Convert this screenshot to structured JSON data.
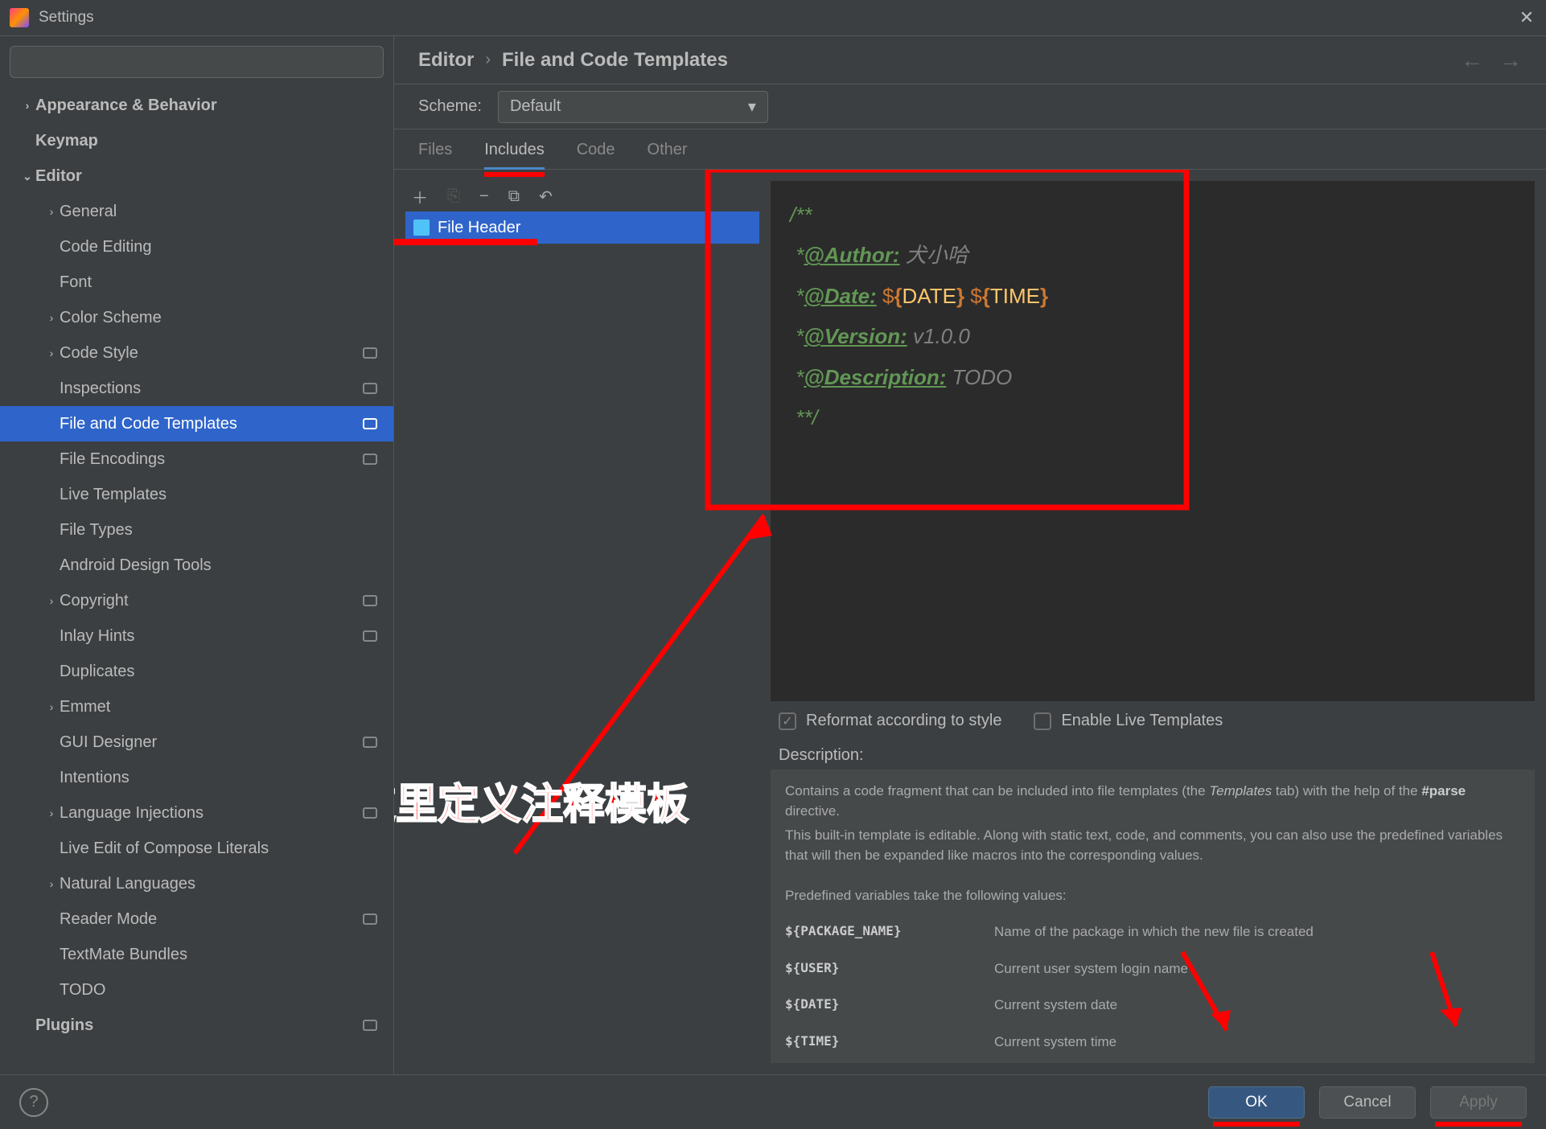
{
  "window": {
    "title": "Settings"
  },
  "sidebar": {
    "search_placeholder": "",
    "items": [
      {
        "label": "Appearance & Behavior",
        "depth": 1,
        "chevron": "right",
        "bold": true
      },
      {
        "label": "Keymap",
        "depth": 1,
        "chevron": "",
        "bold": true
      },
      {
        "label": "Editor",
        "depth": 1,
        "chevron": "down",
        "bold": true
      },
      {
        "label": "General",
        "depth": 2,
        "chevron": "right"
      },
      {
        "label": "Code Editing",
        "depth": 2,
        "chevron": ""
      },
      {
        "label": "Font",
        "depth": 2,
        "chevron": ""
      },
      {
        "label": "Color Scheme",
        "depth": 2,
        "chevron": "right"
      },
      {
        "label": "Code Style",
        "depth": 2,
        "chevron": "right",
        "badge": true
      },
      {
        "label": "Inspections",
        "depth": 2,
        "chevron": "",
        "badge": true
      },
      {
        "label": "File and Code Templates",
        "depth": 2,
        "chevron": "",
        "selected": true,
        "badge": true
      },
      {
        "label": "File Encodings",
        "depth": 2,
        "chevron": "",
        "badge": true
      },
      {
        "label": "Live Templates",
        "depth": 2,
        "chevron": ""
      },
      {
        "label": "File Types",
        "depth": 2,
        "chevron": ""
      },
      {
        "label": "Android Design Tools",
        "depth": 2,
        "chevron": ""
      },
      {
        "label": "Copyright",
        "depth": 2,
        "chevron": "right",
        "badge": true
      },
      {
        "label": "Inlay Hints",
        "depth": 2,
        "chevron": "",
        "badge": true
      },
      {
        "label": "Duplicates",
        "depth": 2,
        "chevron": ""
      },
      {
        "label": "Emmet",
        "depth": 2,
        "chevron": "right"
      },
      {
        "label": "GUI Designer",
        "depth": 2,
        "chevron": "",
        "badge": true
      },
      {
        "label": "Intentions",
        "depth": 2,
        "chevron": ""
      },
      {
        "label": "Language Injections",
        "depth": 2,
        "chevron": "right",
        "badge": true
      },
      {
        "label": "Live Edit of Compose Literals",
        "depth": 2,
        "chevron": ""
      },
      {
        "label": "Natural Languages",
        "depth": 2,
        "chevron": "right"
      },
      {
        "label": "Reader Mode",
        "depth": 2,
        "chevron": "",
        "badge": true
      },
      {
        "label": "TextMate Bundles",
        "depth": 2,
        "chevron": ""
      },
      {
        "label": "TODO",
        "depth": 2,
        "chevron": ""
      },
      {
        "label": "Plugins",
        "depth": 1,
        "chevron": "",
        "bold": true,
        "badge": true
      }
    ]
  },
  "breadcrumb": {
    "main": "Editor",
    "sub": "File and Code Templates"
  },
  "scheme": {
    "label": "Scheme:",
    "value": "Default"
  },
  "tabs": [
    {
      "label": "Files"
    },
    {
      "label": "Includes",
      "active": true,
      "underline_red": true
    },
    {
      "label": "Code"
    },
    {
      "label": "Other"
    }
  ],
  "list": {
    "items": [
      {
        "label": "File Header",
        "selected": true
      }
    ]
  },
  "code": {
    "l1": "/**",
    "l2_star": " *",
    "l2_tag": "@Author:",
    "l2_val": " 犬小哈",
    "l3_star": " *",
    "l3_tag": "@Date:",
    "l3_dollar": " $",
    "l3_bo": "{",
    "l3_var": "DATE",
    "l3_bc": "}",
    "l3_dollar2": " $",
    "l3_bo2": "{",
    "l3_var2": "TIME",
    "l3_bc2": "}",
    "l4_star": " *",
    "l4_tag": "@Version:",
    "l4_val": " v1.0.0",
    "l5_star": " *",
    "l5_tag": "@Description:",
    "l5_val": " TODO",
    "l6": " **/"
  },
  "options": {
    "reformat": "Reformat according to style",
    "livetpl": "Enable Live Templates"
  },
  "description": {
    "label": "Description:",
    "text1a": "Contains a code fragment that can be included into file templates (the ",
    "text1_em": "Templates",
    "text1b": " tab) with the help of the ",
    "text1_bold": "#parse",
    "text1c": " directive.",
    "text2": "This built-in template is editable. Along with static text, code, and comments, you can also use the predefined variables that will then be expanded like macros into the corresponding values.",
    "text3": "Predefined variables take the following values:",
    "vars": [
      {
        "name": "${PACKAGE_NAME}",
        "desc": "Name of the package in which the new file is created"
      },
      {
        "name": "${USER}",
        "desc": "Current user system login name"
      },
      {
        "name": "${DATE}",
        "desc": "Current system date"
      },
      {
        "name": "${TIME}",
        "desc": "Current system time"
      }
    ]
  },
  "footer": {
    "ok": "OK",
    "cancel": "Cancel",
    "apply": "Apply"
  },
  "annotation": {
    "text": "这里定义注释模板"
  }
}
